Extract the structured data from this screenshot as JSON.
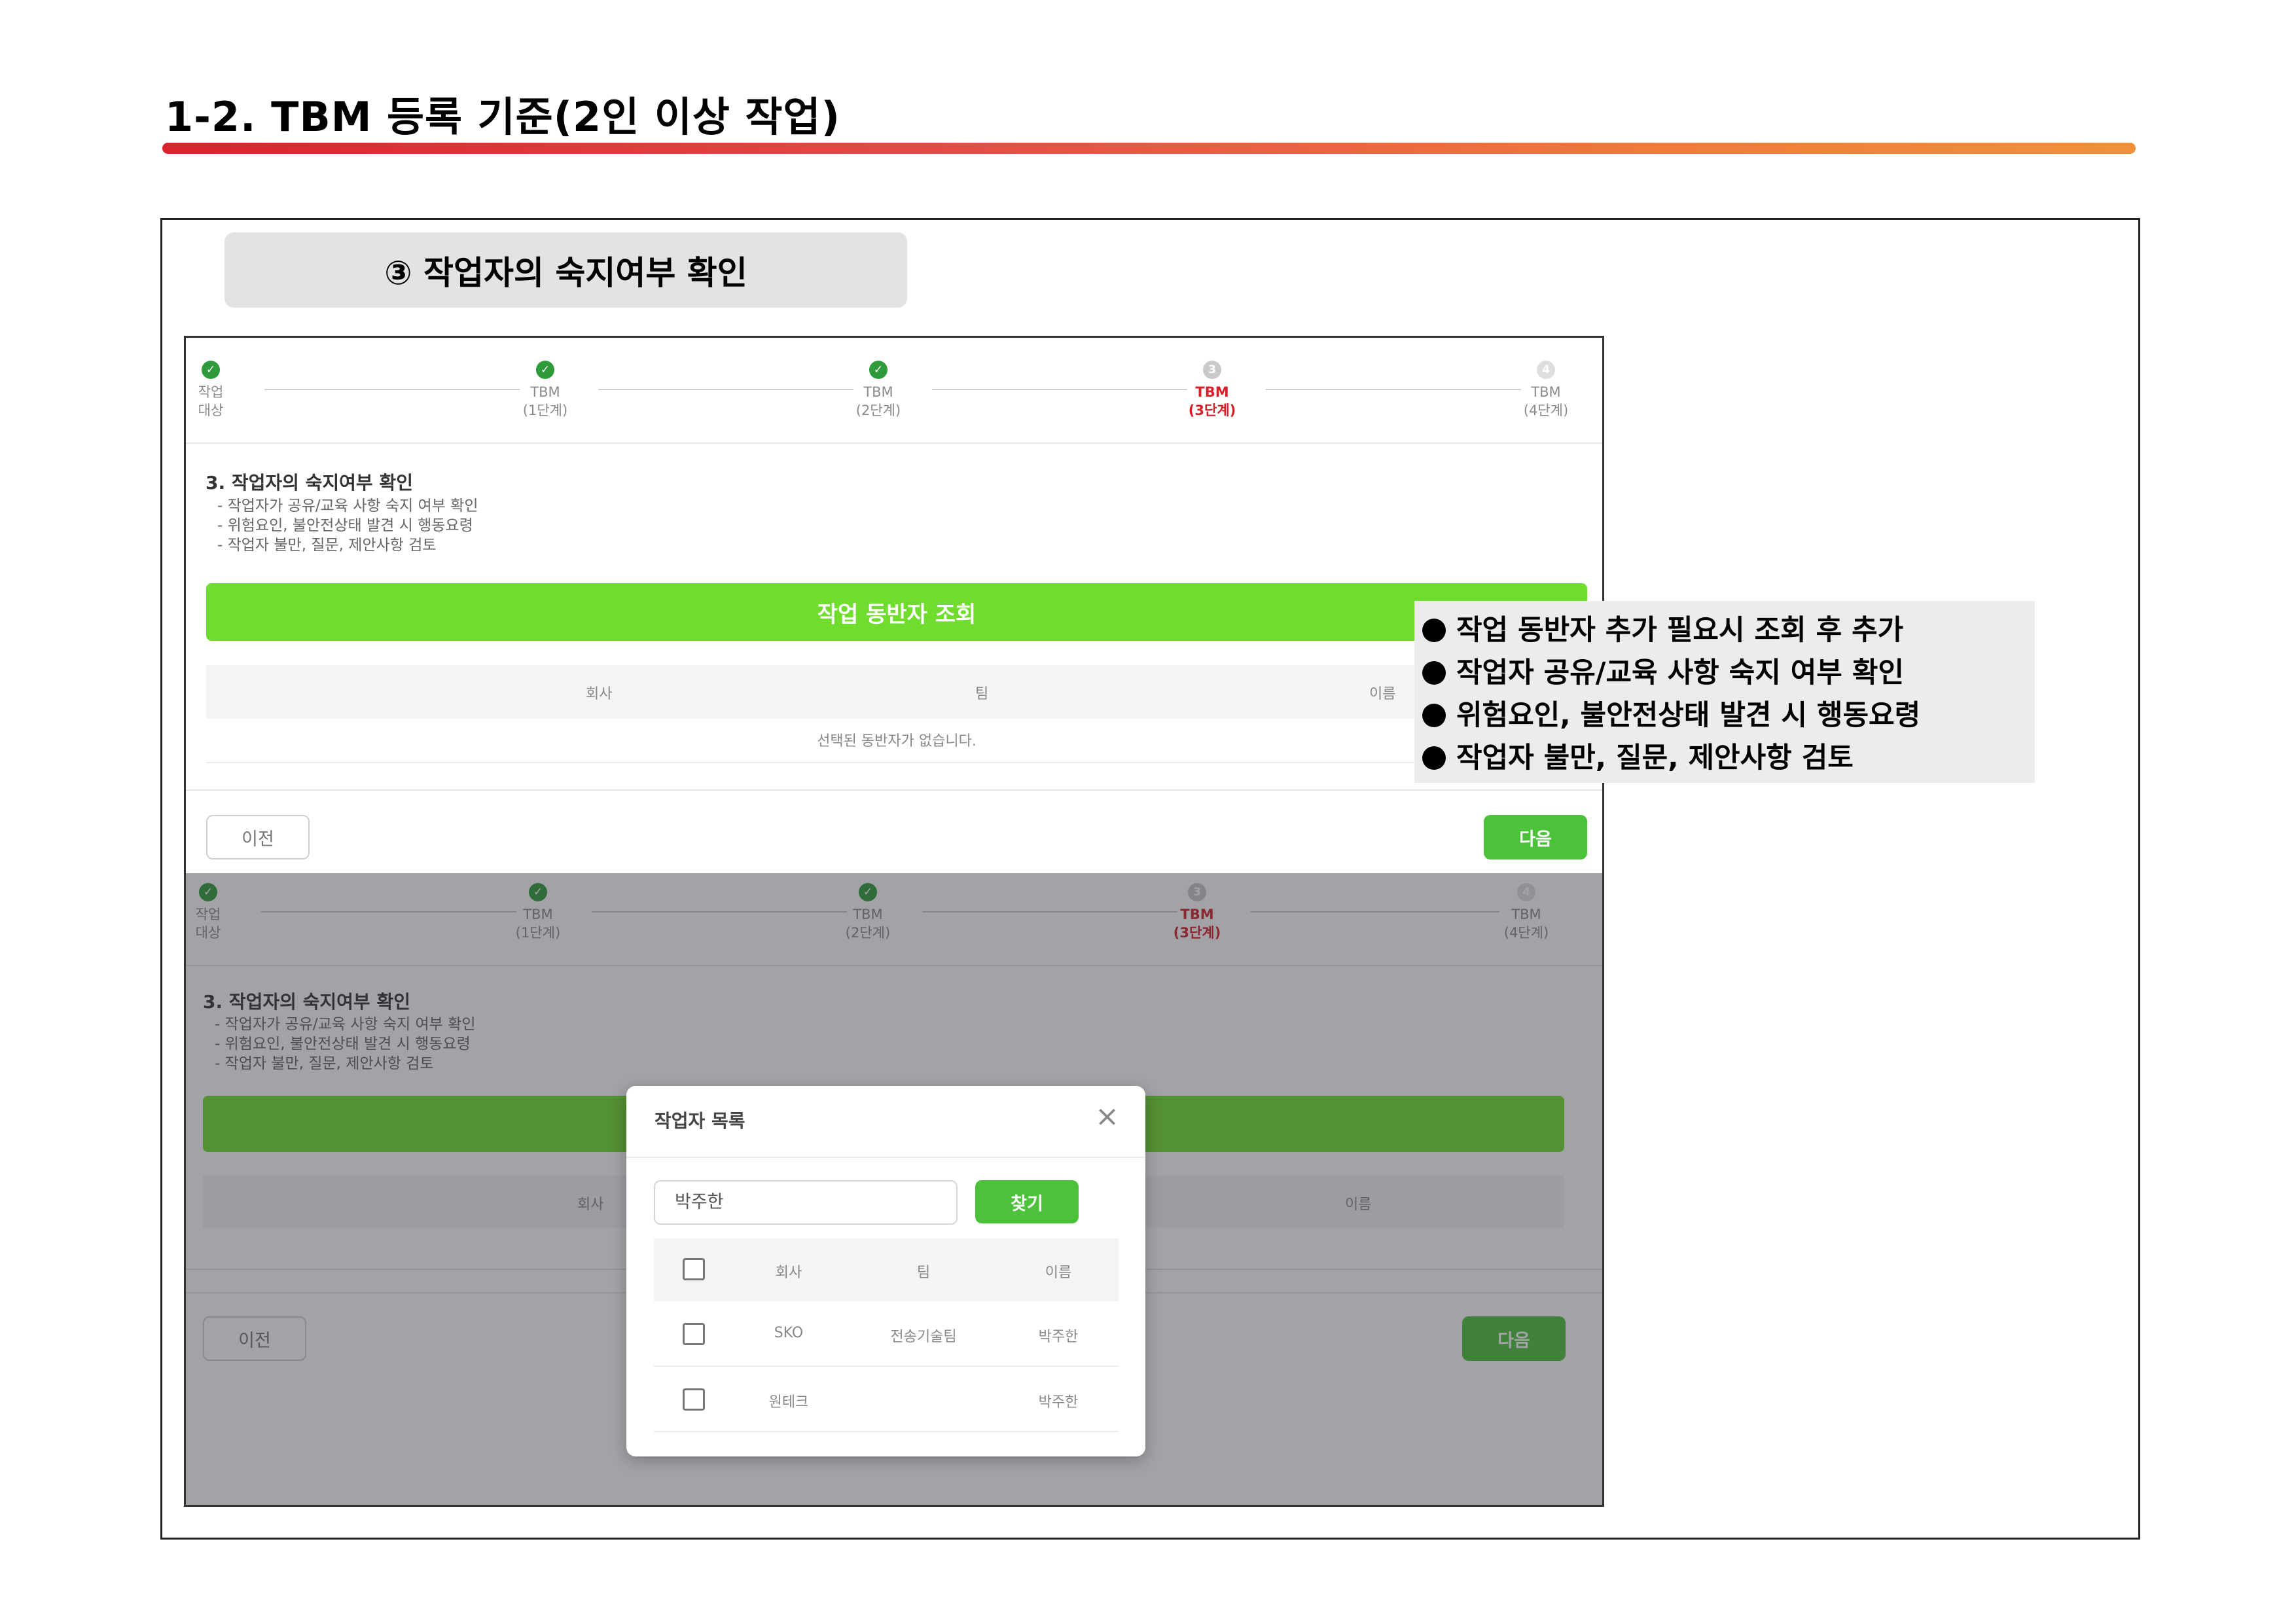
{
  "page": {
    "title": "1-2. TBM 등록 기준(2인 이상 작업)",
    "step_label": "③ 작업자의 숙지여부 확인"
  },
  "stepper": {
    "steps": [
      {
        "line1": "작업",
        "line2": "대상",
        "state": "done"
      },
      {
        "line1": "TBM",
        "line2": "(1단계)",
        "state": "done"
      },
      {
        "line1": "TBM",
        "line2": "(2단계)",
        "state": "done"
      },
      {
        "line1": "TBM",
        "line2": "(3단계)",
        "state": "active",
        "dot": "3"
      },
      {
        "line1": "TBM",
        "line2": "(4단계)",
        "state": "todo",
        "dot": "4"
      }
    ]
  },
  "section": {
    "title": "3. 작업자의 숙지여부 확인",
    "bullets": [
      "- 작업자가 공유/교육 사항 숙지 여부 확인",
      "- 위험요인, 불안전상태 발견 시 행동요령",
      "- 작업자 불만, 질문, 제안사항 검토"
    ]
  },
  "companion_button": "작업 동반자 조회",
  "table": {
    "headers": [
      "회사",
      "팀",
      "이름"
    ],
    "empty_message": "선택된 동반자가 없습니다."
  },
  "nav": {
    "prev": "이전",
    "next": "다음"
  },
  "modal": {
    "title": "작업자 목록",
    "search_value": "박주한",
    "search_button": "찾기",
    "headers": [
      "회사",
      "팀",
      "이름"
    ],
    "rows": [
      {
        "company": "SKO",
        "team": "전송기술팀",
        "name": "박주한"
      },
      {
        "company": "원테크",
        "team": "",
        "name": "박주한"
      }
    ]
  },
  "callout": {
    "items": [
      "작업 동반자 추가 필요시 조회 후 추가",
      "작업자 공유/교육 사항 숙지 여부 확인",
      "위험요인, 불안전상태 발견 시 행동요령",
      "작업자 불만, 질문, 제안사항 검토"
    ]
  },
  "colors": {
    "accent_green": "#6fdc2e",
    "button_green": "#4cc23b",
    "done_green": "#2e9a3a",
    "active_red": "#d4212a"
  }
}
